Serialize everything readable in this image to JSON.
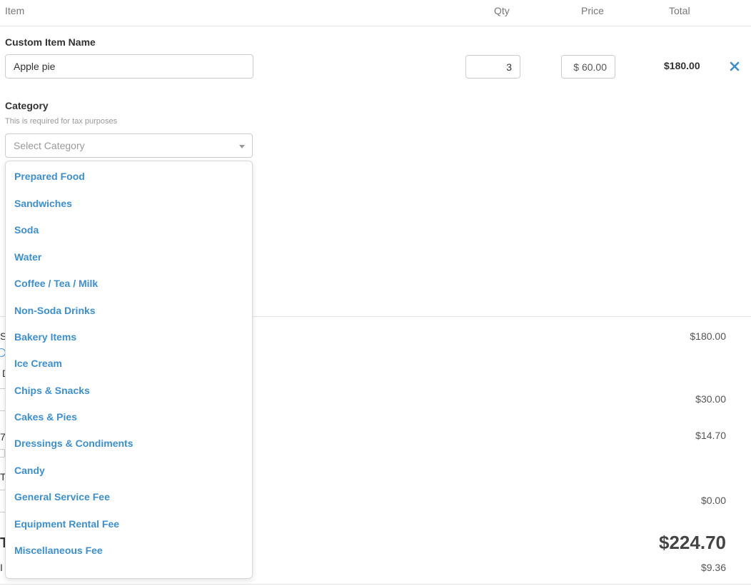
{
  "header": {
    "item": "Item",
    "qty": "Qty",
    "price": "Price",
    "total": "Total"
  },
  "item": {
    "name_label": "Custom Item Name",
    "name_value": "Apple pie",
    "qty_value": "3",
    "price_value": "$ 60.00",
    "line_total": "$180.00",
    "remove_icon": "close-icon",
    "accent_color": "#3d8fd1"
  },
  "category": {
    "label": "Category",
    "hint": "This is required for tax purposes",
    "placeholder": "Select Category",
    "options": [
      "Prepared Food",
      "Sandwiches",
      "Soda",
      "Water",
      "Coffee / Tea / Milk",
      "Non-Soda Drinks",
      "Bakery Items",
      "Ice Cream",
      "Chips & Snacks",
      "Cakes & Pies",
      "Dressings & Condiments",
      "Candy",
      "General Service Fee",
      "Equipment Rental Fee",
      "Miscellaneous Fee"
    ]
  },
  "summary": {
    "peek_letters": [
      "S",
      "D",
      "7",
      "T",
      "T",
      "I"
    ],
    "subtotal": "$180.00",
    "discount": "$30.00",
    "tax": "$14.70",
    "fee": "$0.00",
    "total": "$224.70",
    "last": "$9.36"
  }
}
